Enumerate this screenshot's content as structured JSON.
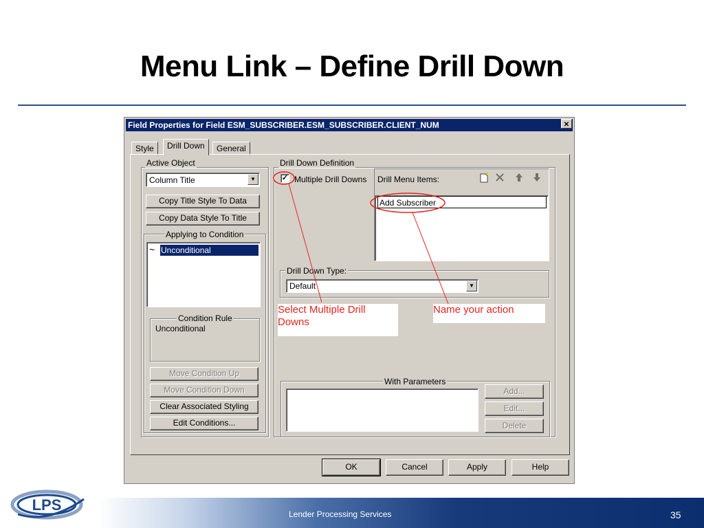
{
  "slide": {
    "title": "Menu Link – Define Drill Down",
    "footer_company": "Lender Processing Services",
    "page_number": "35",
    "logo_text": "LPS"
  },
  "dialog": {
    "title": "Field Properties for Field ESM_SUBSCRIBER.ESM_SUBSCRIBER.CLIENT_NUM",
    "close_glyph": "✕",
    "tabs": [
      "Style",
      "Drill Down",
      "General"
    ],
    "active_tab": "Drill Down",
    "active_object": {
      "group_label": "Active Object",
      "select_value": "Column Title",
      "copy_title_button": "Copy Title Style To Data",
      "copy_data_button": "Copy Data Style To Title",
      "applying_group_label": "Applying to Condition",
      "conditions": [
        {
          "glyph": "~",
          "label": "Unconditional",
          "selected": true
        }
      ],
      "condition_rule_label": "Condition Rule",
      "condition_rule_value": "Unconditional",
      "move_up_button": "Move Condition Up",
      "move_down_button": "Move Condition Down",
      "clear_styling_button": "Clear Associated Styling",
      "edit_conditions_button": "Edit Conditions..."
    },
    "drill_down_definition": {
      "group_label": "Drill Down Definition",
      "multiple_checkbox_label": "Multiple Drill Downs",
      "multiple_checked": true,
      "menu_items_label": "Drill Menu Items:",
      "menu_item_value": "Add Subscriber",
      "type_group_label": "Drill Down Type:",
      "type_value": "Default",
      "params_group_label": "With Parameters",
      "add_button": "Add...",
      "edit_button": "Edit...",
      "delete_button": "Delete"
    },
    "footer_buttons": [
      "OK",
      "Cancel",
      "Apply",
      "Help"
    ]
  },
  "annotations": {
    "callout_multiple": "Select Multiple Drill Downs",
    "callout_name": "Name your action",
    "annotation_color": "#e8231e"
  },
  "colors": {
    "titlebar": "#0a246a",
    "dialog_face": "#d4d0c8",
    "selection": "#0a246a",
    "rule": "#2a4f8a"
  }
}
